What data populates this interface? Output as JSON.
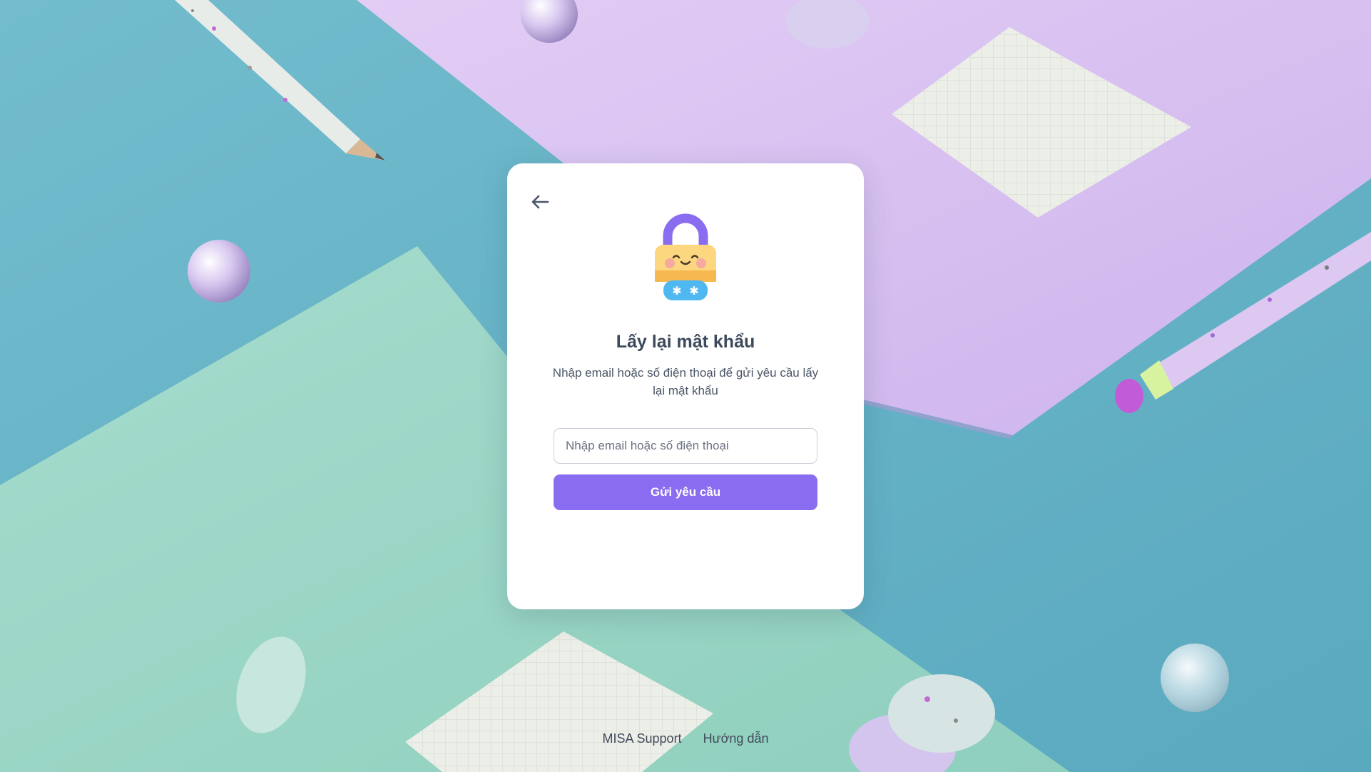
{
  "card": {
    "title": "Lấy lại mật khẩu",
    "subtitle": "Nhập email hoặc số điện thoại để gửi yêu cầu lấy lại mật khẩu",
    "input_placeholder": "Nhập email hoặc số điện thoại",
    "input_value": "",
    "submit_label": "Gửi yêu cầu",
    "back_icon": "arrow-left-icon",
    "illustration_icon": "padlock-icon"
  },
  "footer": {
    "support_label": "MISA Support",
    "guide_label": "Hướng dẫn"
  },
  "colors": {
    "accent": "#8a6cf0",
    "title_text": "#3d4a5c",
    "background_teal": "#6fb7c9",
    "background_lilac": "#d6c2f0",
    "background_mint": "#9fd6c8"
  }
}
